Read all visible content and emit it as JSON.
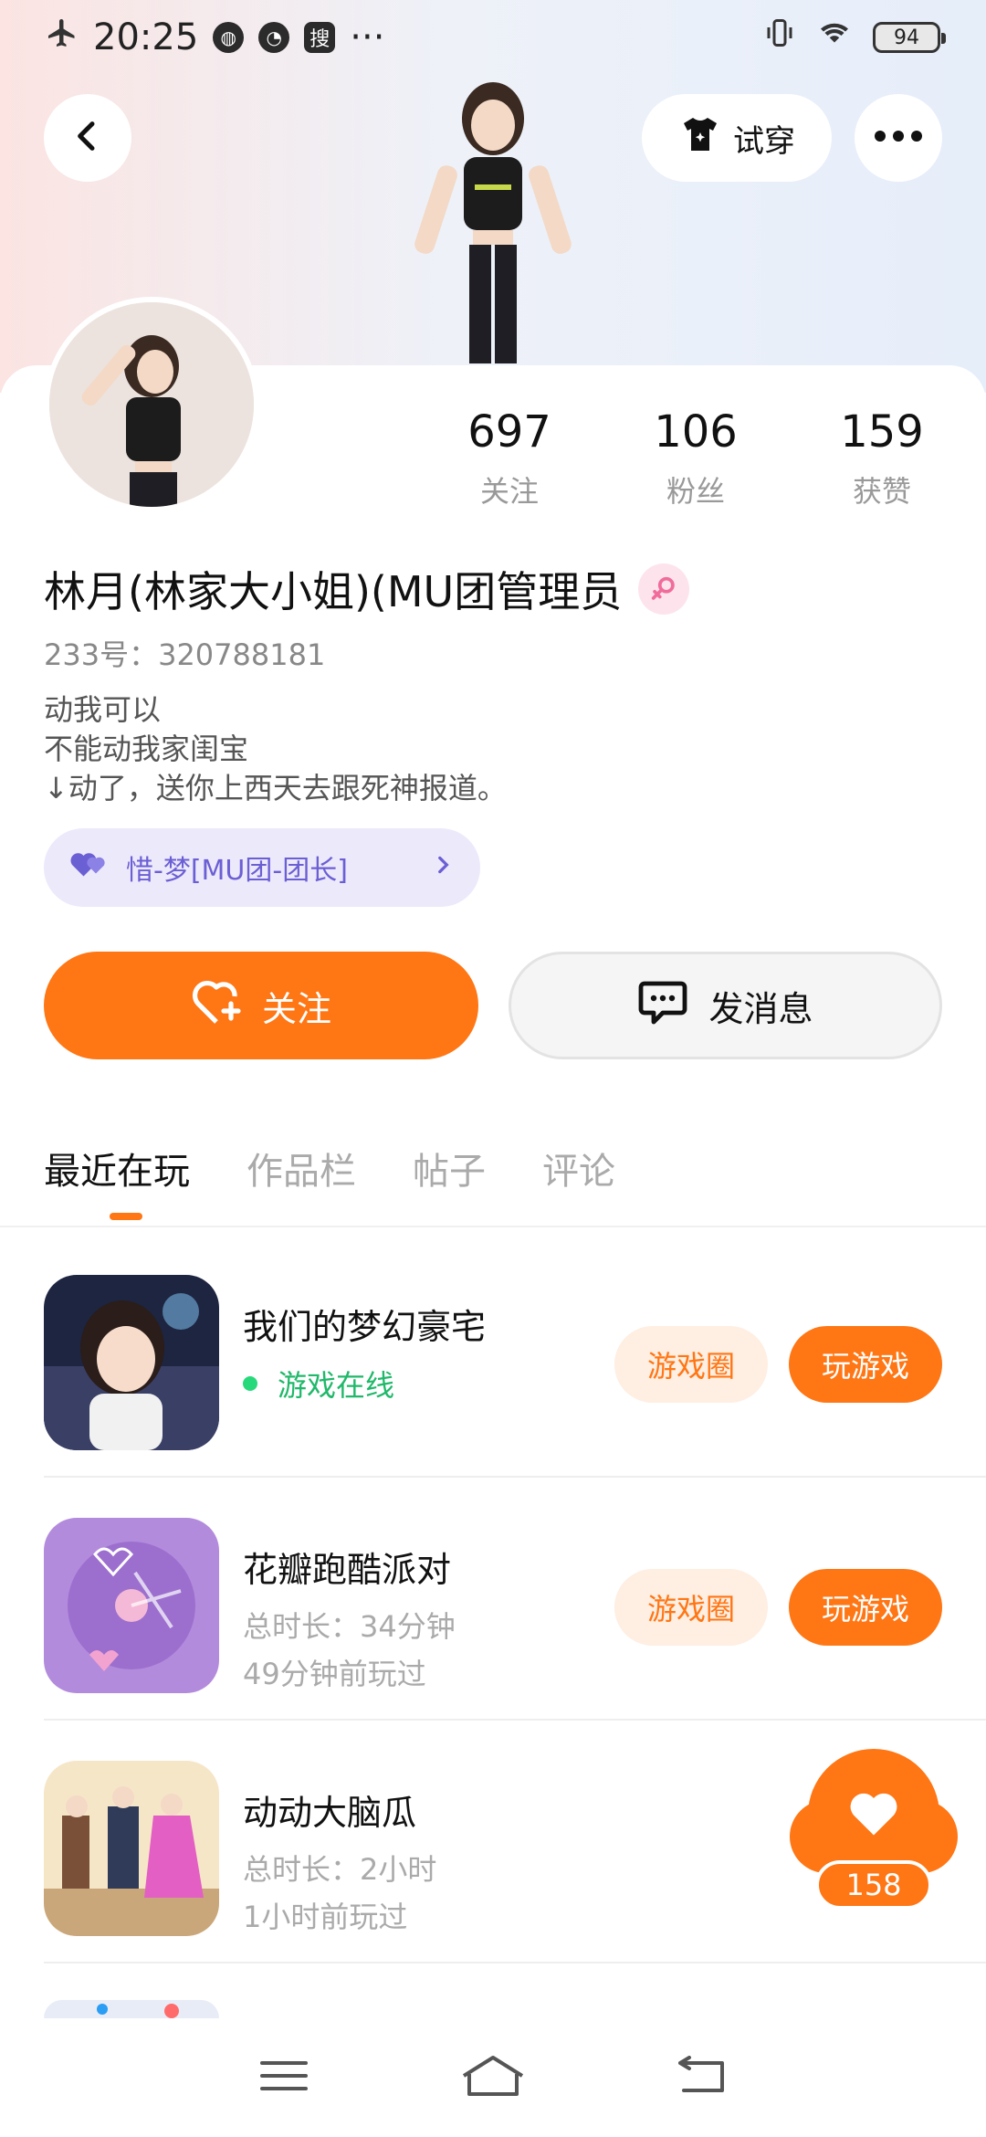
{
  "status_bar": {
    "time": "20:25",
    "app_badge": "搜",
    "more": "···",
    "battery": "94"
  },
  "header": {
    "try_on_label": "试穿"
  },
  "profile": {
    "stats": [
      {
        "num": "697",
        "label": "关注"
      },
      {
        "num": "106",
        "label": "粉丝"
      },
      {
        "num": "159",
        "label": "获赞"
      }
    ],
    "name": "林月(林家大小姐)(MU团管理员",
    "uid": "233号：320788181",
    "bio_lines": [
      "动我可以",
      "不能动我家闺宝",
      "↓动了，送你上西天去跟死神报道。"
    ],
    "tag": "惜-梦[MU团-团长]"
  },
  "actions": {
    "follow": "关注",
    "message": "发消息"
  },
  "tabs": [
    "最近在玩",
    "作品栏",
    "帖子",
    "评论"
  ],
  "games": [
    {
      "title": "我们的梦幻豪宅",
      "status": "游戏在线",
      "circle": "游戏圈",
      "play": "玩游戏"
    },
    {
      "title": "花瓣跑酷派对",
      "duration": "总时长：34分钟",
      "last": "49分钟前玩过",
      "circle": "游戏圈",
      "play": "玩游戏"
    },
    {
      "title": "动动大脑瓜",
      "duration": "总时长：2小时",
      "last": "1小时前玩过"
    }
  ],
  "fab": {
    "count": "158"
  },
  "colors": {
    "accent": "#ff7614",
    "online": "#20b86a",
    "tag_text": "#6b5fd4"
  }
}
